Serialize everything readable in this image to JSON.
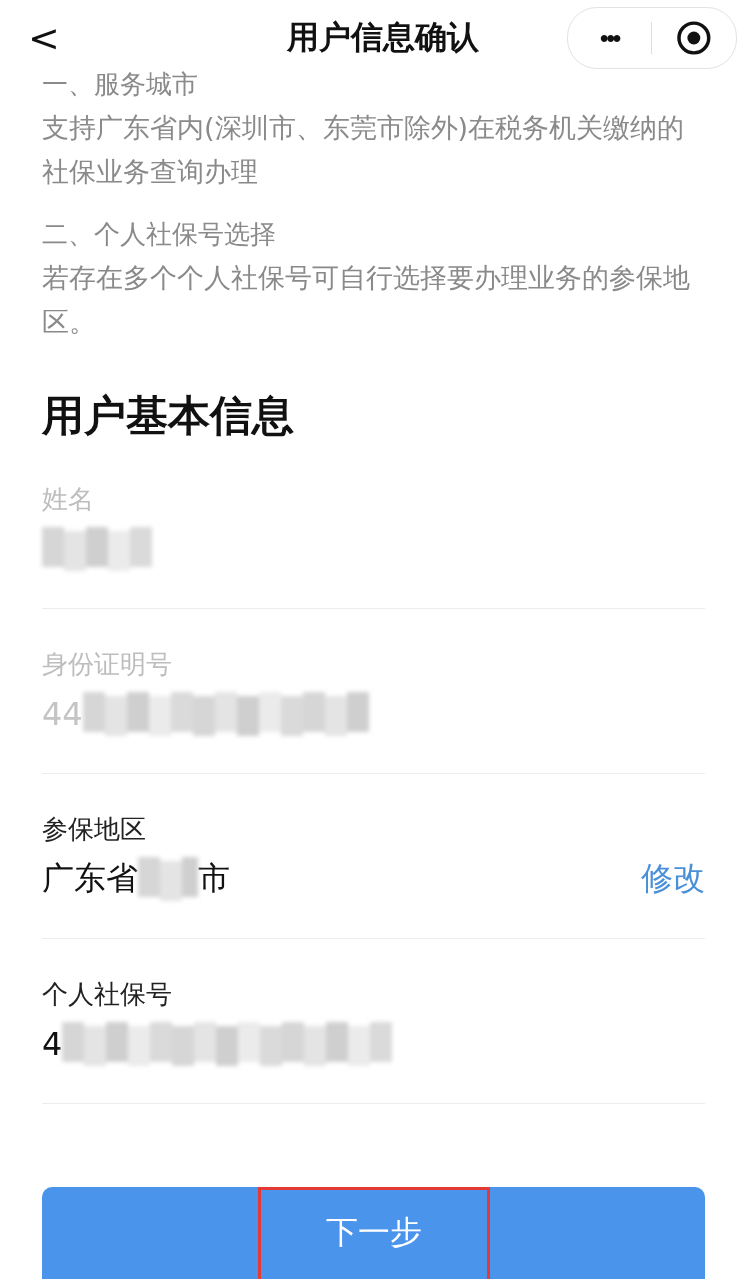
{
  "nav": {
    "back": "<",
    "title": "用户信息确认",
    "more": "•••"
  },
  "notes": [
    {
      "heading": "一、服务城市",
      "body": "支持广东省内(深圳市、东莞市除外)在税务机关缴纳的社保业务查询办理"
    },
    {
      "heading": "二、个人社保号选择",
      "body": "若存在多个个人社保号可自行选择要办理业务的参保地区。"
    }
  ],
  "section_title": "用户基本信息",
  "fields": [
    {
      "label": "姓名",
      "disabled": true,
      "value": [
        {
          "kind": "mask"
        }
      ]
    },
    {
      "label": "身份证明号",
      "disabled": true,
      "value": [
        {
          "kind": "text",
          "text": "44"
        },
        {
          "kind": "mask"
        }
      ]
    },
    {
      "label": "参保地区",
      "disabled": false,
      "value": [
        {
          "kind": "text",
          "text": "广东省"
        },
        {
          "kind": "mask"
        },
        {
          "kind": "text",
          "text": "市"
        }
      ],
      "action": "修改"
    },
    {
      "label": "个人社保号",
      "disabled": false,
      "value": [
        {
          "kind": "text",
          "text": "4"
        },
        {
          "kind": "mask"
        }
      ]
    }
  ],
  "next_button": {
    "label": "下一步",
    "highlighted": true
  }
}
